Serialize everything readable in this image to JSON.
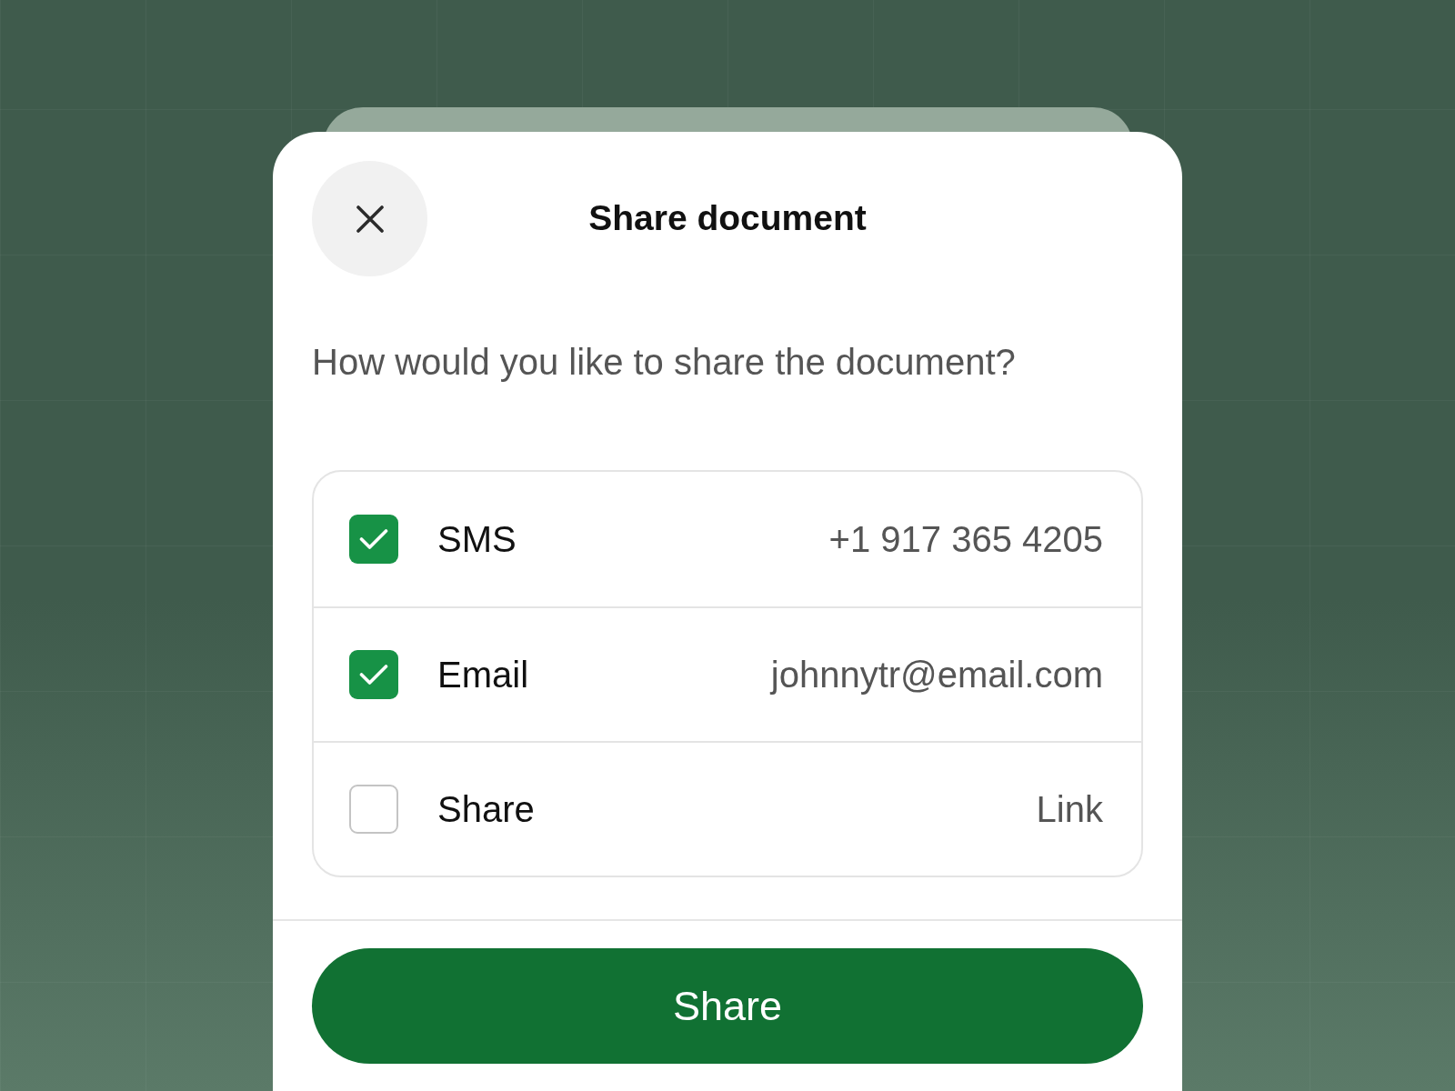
{
  "dialog": {
    "title": "Share document",
    "prompt": "How would you like to share the document?"
  },
  "options": [
    {
      "label": "SMS",
      "value": "+1 917 365 4205",
      "checked": true
    },
    {
      "label": "Email",
      "value": "johnnytr@email.com",
      "checked": true
    },
    {
      "label": "Share",
      "value": "Link",
      "checked": false
    }
  ],
  "primary_button": {
    "label": "Share"
  }
}
